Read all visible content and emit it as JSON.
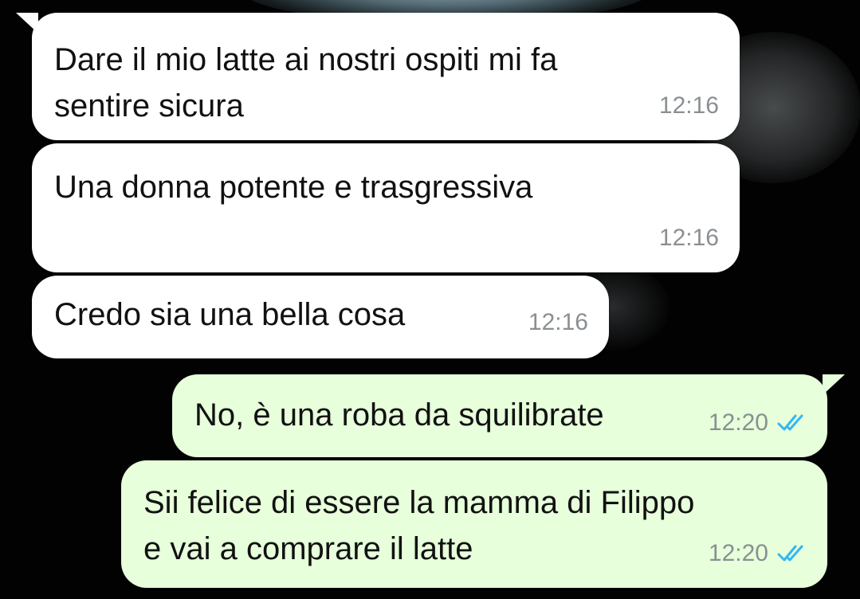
{
  "messages": [
    {
      "direction": "incoming",
      "text": "Dare il mio latte ai nostri ospiti mi fa\nsentire sicura",
      "time": "12:16"
    },
    {
      "direction": "incoming",
      "text": "Una donna potente e trasgressiva",
      "time": "12:16"
    },
    {
      "direction": "incoming",
      "text": "Credo sia una bella cosa",
      "time": "12:16"
    },
    {
      "direction": "outgoing",
      "text": "No, è una roba da squilibrate",
      "time": "12:20",
      "status_icon": "double-check-icon",
      "status_color": "#34b7f1"
    },
    {
      "direction": "outgoing",
      "text": "Sii felice di essere la mamma di Filippo\ne vai a comprare il latte",
      "time": "12:20",
      "status_icon": "double-check-icon",
      "status_color": "#34b7f1"
    }
  ],
  "colors": {
    "incoming_bubble": "#ffffff",
    "outgoing_bubble": "#e7ffdb",
    "timestamp": "#8a8f93",
    "read_ticks": "#34b7f1",
    "background": "#000000"
  }
}
